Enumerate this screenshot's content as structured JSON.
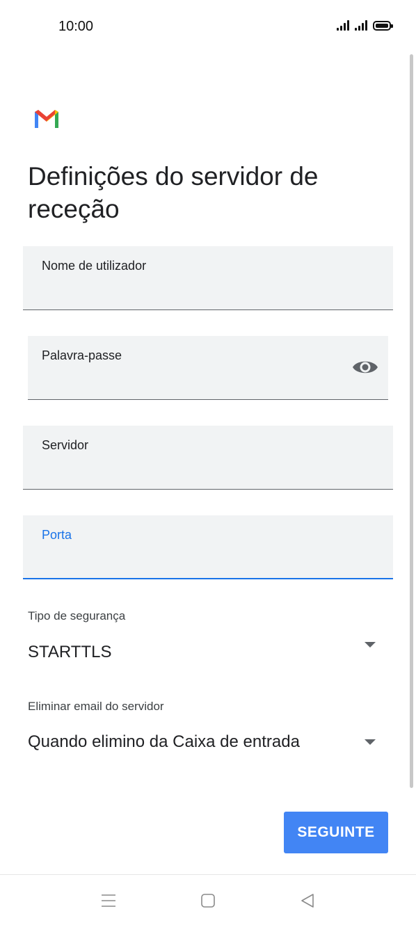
{
  "status_bar": {
    "time": "10:00"
  },
  "page": {
    "title": "Definições do servidor de receção"
  },
  "fields": {
    "username": {
      "label": "Nome de utilizador",
      "value": ""
    },
    "password": {
      "label": "Palavra-passe",
      "value": ""
    },
    "server": {
      "label": "Servidor",
      "value": ""
    },
    "port": {
      "label": "Porta",
      "value": ""
    }
  },
  "security": {
    "label": "Tipo de segurança",
    "value": "STARTTLS"
  },
  "delete_from_server": {
    "label": "Eliminar email do servidor",
    "value": "Quando elimino da Caixa de entrada"
  },
  "actions": {
    "next": "SEGUINTE"
  },
  "icons": {
    "logo": "gmail-logo",
    "password_toggle": "eye-icon",
    "dropdown": "caret-down-icon",
    "nav": [
      "menu-icon",
      "home-square-icon",
      "back-triangle-icon"
    ]
  },
  "colors": {
    "accent": "#1a73e8",
    "button": "#4285f4",
    "field_bg": "#f1f3f4"
  }
}
